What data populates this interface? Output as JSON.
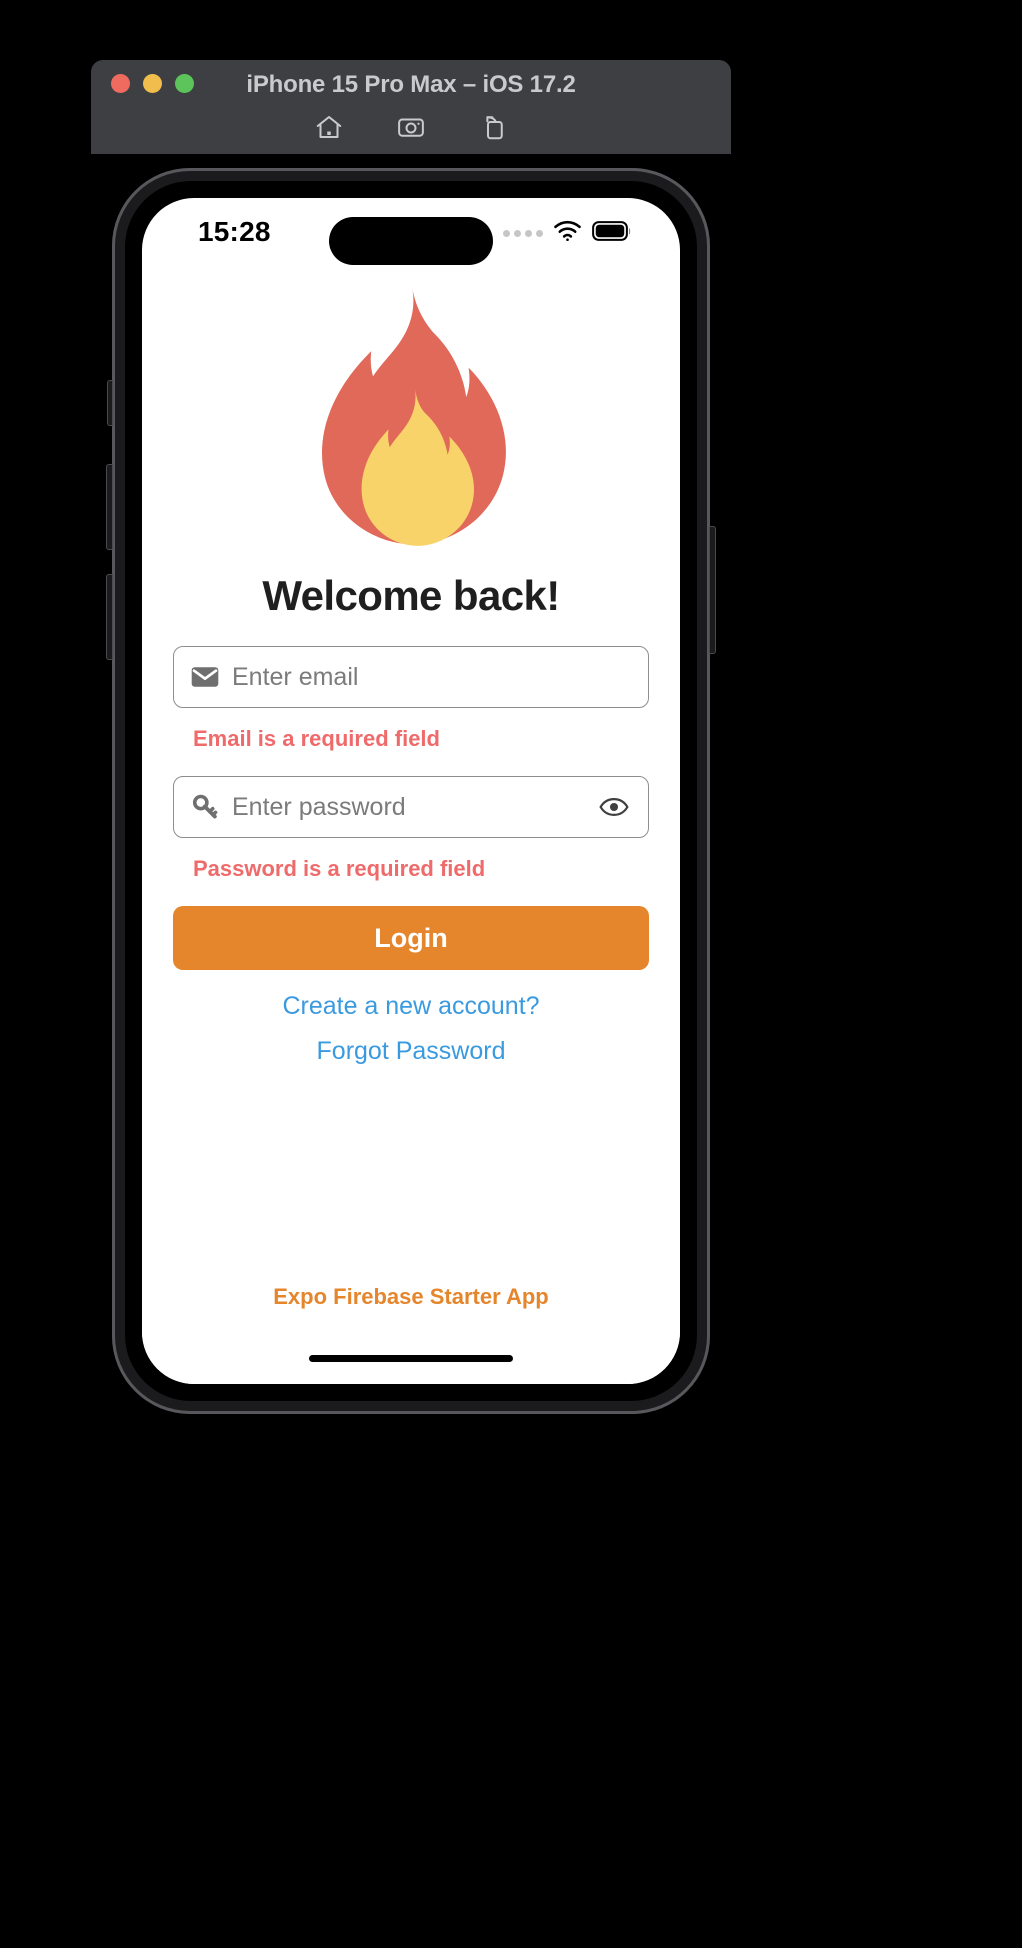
{
  "simulator": {
    "title": "iPhone 15 Pro Max – iOS 17.2",
    "traffic_lights": [
      {
        "name": "close",
        "color": "#ef6b5f"
      },
      {
        "name": "minimize",
        "color": "#f1bd4c"
      },
      {
        "name": "zoom",
        "color": "#5cc45a"
      }
    ],
    "toolbar": [
      {
        "icon": "home-icon",
        "label": "Home"
      },
      {
        "icon": "screenshot-camera-icon",
        "label": "Screenshot"
      },
      {
        "icon": "rotate-device-icon",
        "label": "Rotate"
      }
    ]
  },
  "status_bar": {
    "time": "15:28",
    "cellular_icon": "signal-dots-icon",
    "wifi_icon": "wifi-icon",
    "battery_icon": "battery-full-icon"
  },
  "app": {
    "logo_icon": "flame-logo-icon",
    "heading": "Welcome back!",
    "email_field": {
      "icon": "envelope-icon",
      "value": "",
      "placeholder": "Enter email",
      "error": "Email is a required field"
    },
    "password_field": {
      "icon": "key-icon",
      "value": "",
      "placeholder": "Enter password",
      "toggle_icon": "eye-icon",
      "error": "Password is a required field"
    },
    "login_button": "Login",
    "create_account_link": "Create a new account?",
    "forgot_password_link": "Forgot Password",
    "footer": "Expo Firebase Starter App"
  },
  "colors": {
    "accent_orange": "#e5862c",
    "error_red": "#ef6b6b",
    "link_blue": "#3a9ae0",
    "flame_outer": "#e0695a",
    "flame_inner": "#f8d369",
    "window_chrome": "#3d3f43"
  }
}
